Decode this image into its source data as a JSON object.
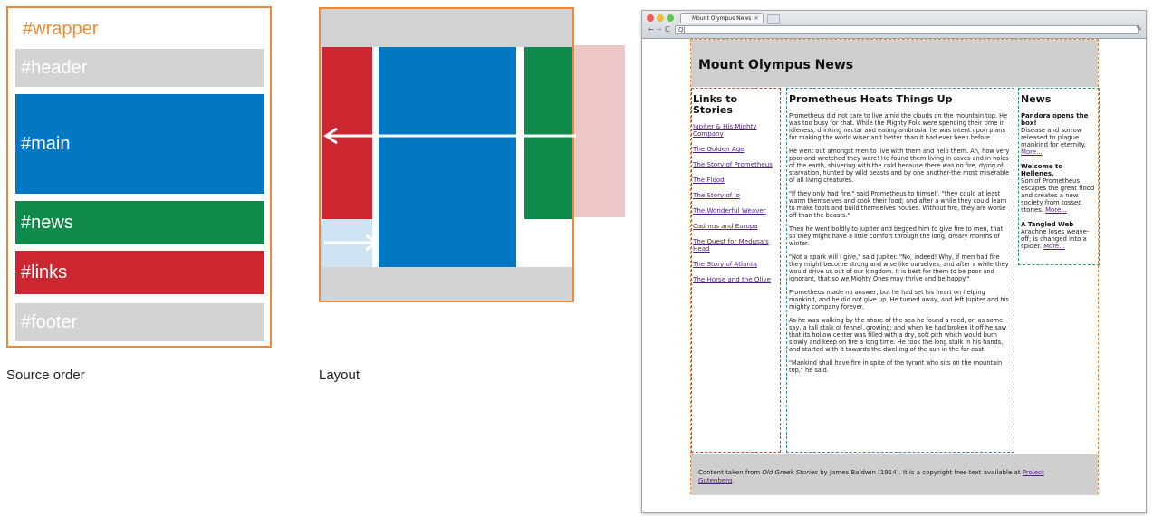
{
  "colors": {
    "wrapper_border": "#ee8a35",
    "header_gray": "#d1d3d4",
    "main_blue": "#0278c3",
    "news_green": "#0f8a4a",
    "links_red": "#cc2730",
    "ghost_pink": "#efc7c9",
    "ghost_blue": "#cfe4f2"
  },
  "source_order": {
    "wrapper": "#wrapper",
    "header": "#header",
    "main": "#main",
    "news": "#news",
    "links": "#links",
    "footer": "#footer",
    "caption": "Source order"
  },
  "layout": {
    "caption": "Layout"
  },
  "browser": {
    "tab_title": "Mount Olympus News",
    "url_text": "Q|",
    "icons": [
      "close-light",
      "minimize-light",
      "zoom-light",
      "back-icon",
      "forward-icon",
      "reload-icon",
      "wrench-icon"
    ],
    "site": {
      "title": "Mount Olympus News",
      "links_heading": "Links to Stories",
      "links": [
        "Jupiter & His Mighty Company",
        "The Golden Age",
        "The Story of Prometheus",
        "The Flood",
        "The Story of Io",
        "The Wonderful Weaver",
        "Cadmus and Europa",
        "The Quest for Medusa's Head",
        "The Story of Atlanta",
        "The Horse and the Olive"
      ],
      "main_heading": "Prometheus Heats Things Up",
      "paragraphs": [
        "Prometheus did not care to live amid the clouds on the mountain top. He was too busy for that. While the Mighty Folk were spending their time in idleness, drinking nectar and eating ambrosia, he was intent upon plans for making the world wiser and better than it had ever been before.",
        "He went out amongst men to live with them and help them. Ah, how very poor and wretched they were! He found them living in caves and in holes of the earth, shivering with the cold because there was no fire, dying of starvation, hunted by wild beasts and by one another-the most miserable of all living creatures.",
        "\"If they only had fire,\" said Prometheus to himself, \"they could at least warm themselves and cook their food; and after a while they could learn to make tools and build themselves houses. Without fire, they are worse off than the beasts.\"",
        "Then he went boldly to Jupiter and begged him to give fire to men, that so they might have a little comfort through the long, dreary months of winter.",
        "\"Not a spark will I give,\" said Jupiter. \"No, indeed! Why, if men had fire they might become strong and wise like ourselves, and after a while they would drive us out of our kingdom. It is best for them to be poor and ignorant, that so we Mighty Ones may thrive and be happy.\"",
        "Prometheus made no answer; but he had set his heart on helping mankind, and he did not give up. He turned away, and left Jupiter and his mighty company forever.",
        "As he was walking by the shore of the sea he found a reed, or, as some say, a tall stalk of fennel, growing; and when he had broken it off he saw that its hollow center was filled with a dry, soft pith which would burn slowly and keep on fire a long time. He took the long stalk in his hands, and started with it towards the dwelling of the sun in the far east.",
        "\"Mankind shall have fire in spite of the tyrant who sits on the mountain top,\" he said."
      ],
      "news_heading": "News",
      "news": [
        {
          "title": "Pandora opens the box!",
          "body": "Disease and sorrow released to plague mankind for eternity.",
          "more": "More..."
        },
        {
          "title": "Welcome to Hellenes.",
          "body": "Son of Prometheus escapes the great flood and creates a new society from tossed stones.",
          "more": "More..."
        },
        {
          "title": "A Tangled Web",
          "body": "Arachne loses weave-off; is changed into a spider.",
          "more": "More..."
        }
      ],
      "footer": {
        "prefix": "Content taken from ",
        "book": "Old Greek Stories",
        "middle": " by James Baldwin (1914). It is a copyright free text available at ",
        "link": "Project Gutenberg",
        "suffix": "."
      }
    }
  }
}
